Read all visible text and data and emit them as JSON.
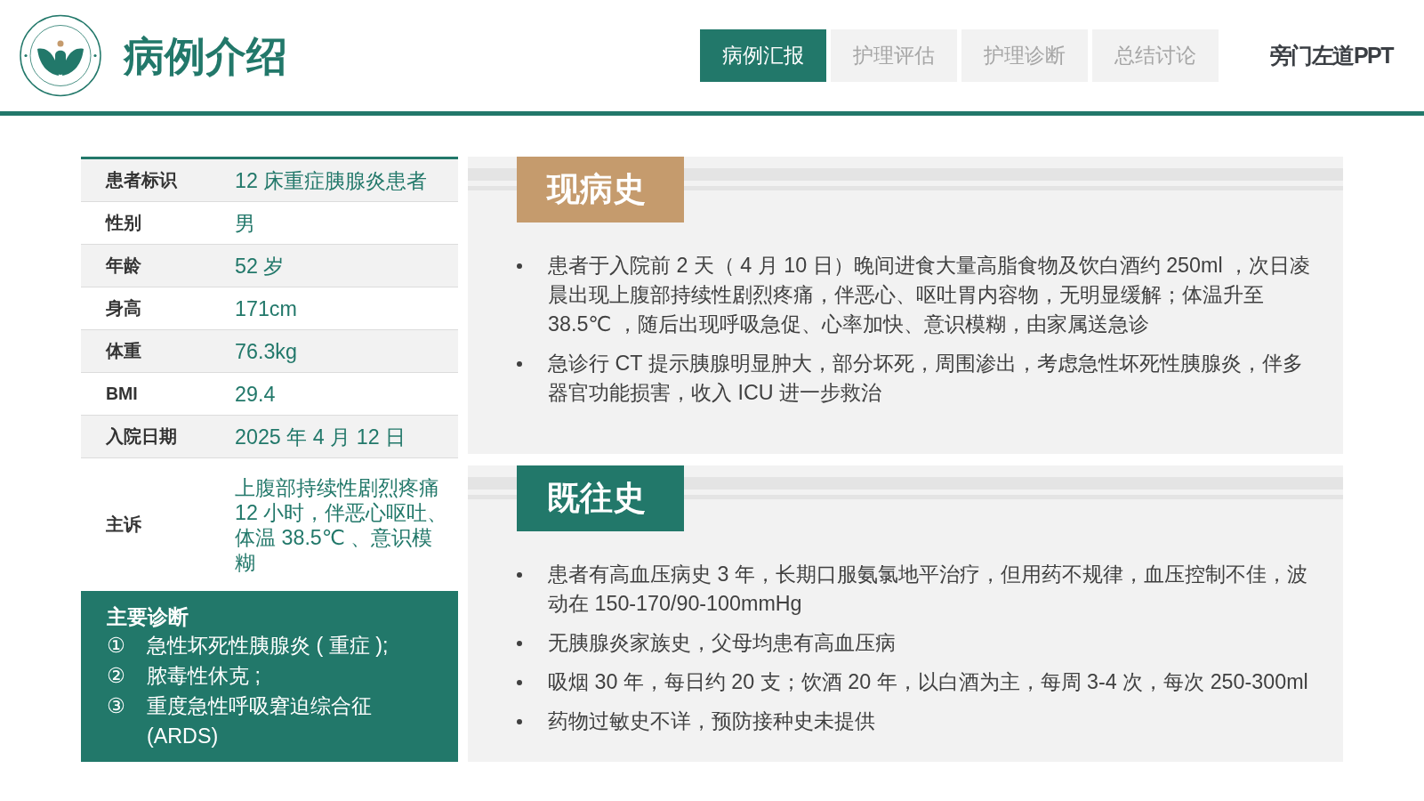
{
  "header": {
    "title": "病例介绍",
    "tabs": [
      {
        "label": "病例汇报",
        "selected": true
      },
      {
        "label": "护理评估",
        "selected": false
      },
      {
        "label": "护理诊断",
        "selected": false
      },
      {
        "label": "总结讨论",
        "selected": false
      }
    ],
    "brand": "旁门左道PPT"
  },
  "patient_info": {
    "rows": [
      {
        "label": "患者标识",
        "value": "12 床重症胰腺炎患者"
      },
      {
        "label": "性别",
        "value": "男"
      },
      {
        "label": "年龄",
        "value": "52 岁"
      },
      {
        "label": "身高",
        "value": "171cm"
      },
      {
        "label": "体重",
        "value": "76.3kg"
      },
      {
        "label": "BMI",
        "value": "29.4"
      },
      {
        "label": "入院日期",
        "value": "2025 年 4 月 12 日"
      },
      {
        "label": "主诉",
        "value": "上腹部持续性剧烈疼痛 12 小时，伴恶心呕吐、体温 38.5℃ 、意识模糊"
      }
    ]
  },
  "diagnosis": {
    "title": "主要诊断",
    "items": [
      {
        "number": "①",
        "text": "急性坏死性胰腺炎 ( 重症 );"
      },
      {
        "number": "②",
        "text": "脓毒性休克 ;"
      },
      {
        "number": "③",
        "text": "重度急性呼吸窘迫综合征 (ARDS)"
      }
    ]
  },
  "sections": [
    {
      "title": "现病史",
      "color": "#c59b6d",
      "bullets": [
        "患者于入院前 2 天（ 4 月 10 日）晚间进食大量高脂食物及饮白酒约 250ml ，次日凌晨出现上腹部持续性剧烈疼痛，伴恶心、呕吐胃内容物，无明显缓解；体温升至 38.5℃ ，随后出现呼吸急促、心率加快、意识模糊，由家属送急诊",
        "急诊行 CT 提示胰腺明显肿大，部分坏死，周围渗出，考虑急性坏死性胰腺炎，伴多器官功能损害，收入 ICU 进一步救治"
      ]
    },
    {
      "title": "既往史",
      "color": "#22786a",
      "bullets": [
        "患者有高血压病史 3 年，长期口服氨氯地平治疗，但用药不规律，血压控制不佳，波动在 150-170/90-100mmHg",
        "无胰腺炎家族史，父母均患有高血压病",
        "吸烟 30 年，每日约 20 支；饮酒 20 年，以白酒为主，每周 3-4 次，每次 250-300ml",
        "药物过敏史不详，预防接种史未提供"
      ]
    }
  ]
}
